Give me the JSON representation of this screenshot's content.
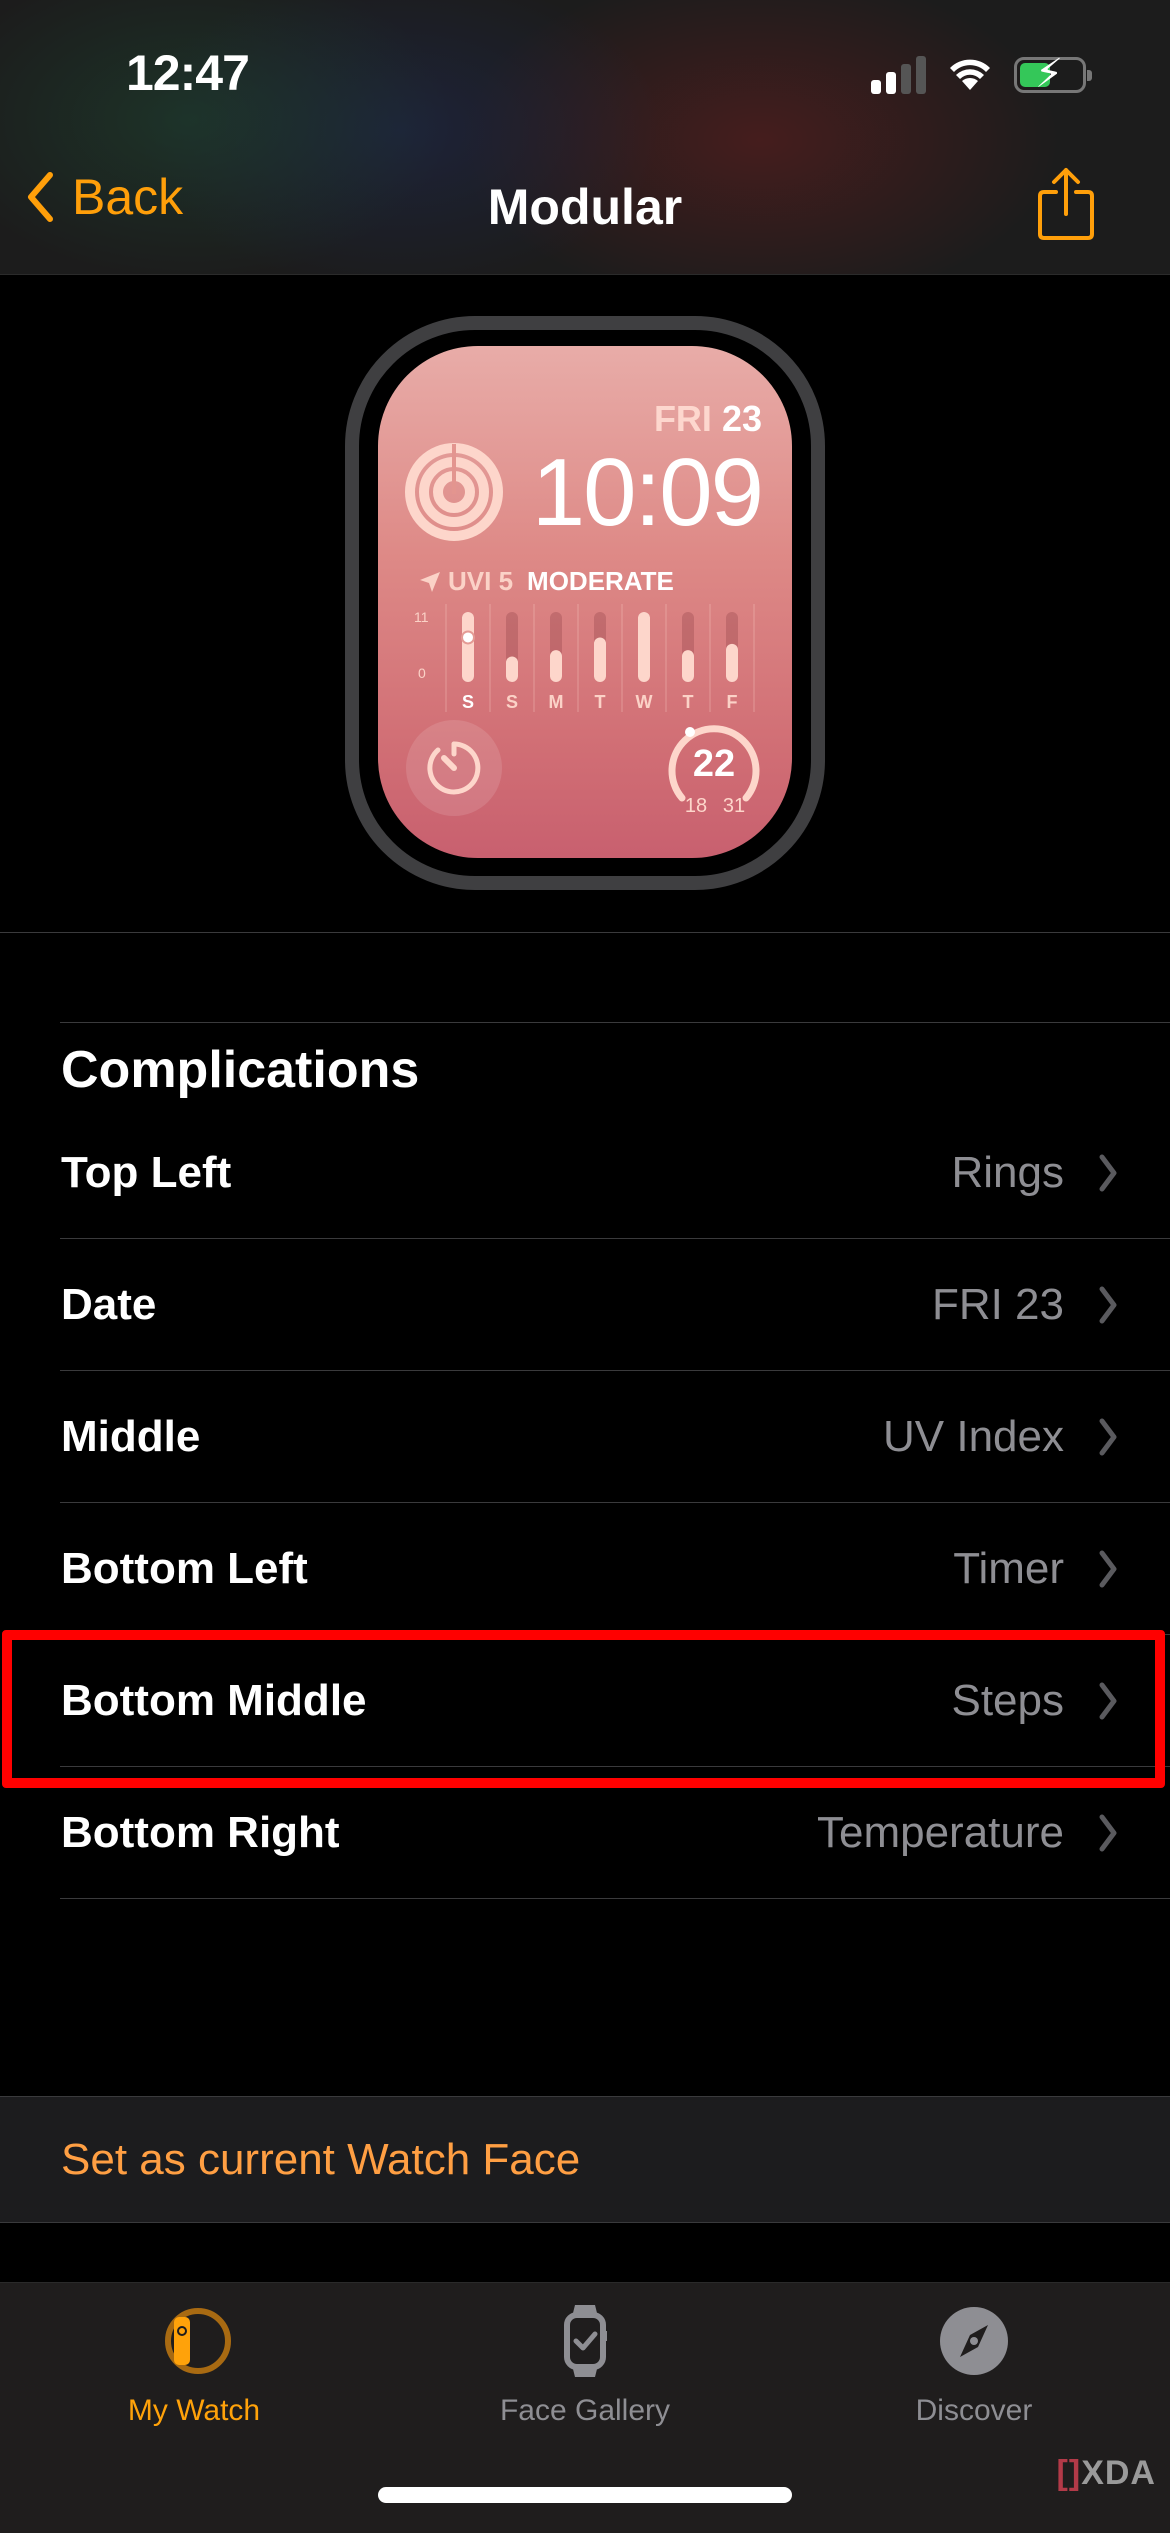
{
  "status_bar": {
    "time": "12:47",
    "signal_bars_active": 2,
    "signal_bars_total": 4,
    "battery_level": 0.5,
    "battery_charging": true,
    "battery_color": "#34c759"
  },
  "nav": {
    "back_label": "Back",
    "title": "Modular",
    "accent_color": "#ff9f0a"
  },
  "watch_face": {
    "day_of_week": "FRI",
    "day": "23",
    "time": "10:09",
    "uv": {
      "label": "UVI 5",
      "category": "MODERATE",
      "axis_max": "11",
      "axis_min": "0"
    },
    "temperature": {
      "current": "22",
      "low": "18",
      "high": "31"
    }
  },
  "chart_data": {
    "type": "bar",
    "title": "UVI 5 MODERATE",
    "categories": [
      "S",
      "S",
      "M",
      "T",
      "W",
      "T",
      "F"
    ],
    "values": [
      11,
      4,
      5,
      7,
      11,
      5,
      6
    ],
    "current_marker": {
      "category_index": 0,
      "value": 7
    },
    "ylim": [
      0,
      11
    ],
    "ytick_labels": [
      "11",
      "0"
    ],
    "xlabel": "",
    "ylabel": ""
  },
  "complications": {
    "heading": "Complications",
    "rows": [
      {
        "label": "Top Left",
        "value": "Rings"
      },
      {
        "label": "Date",
        "value": "FRI 23"
      },
      {
        "label": "Middle",
        "value": "UV Index"
      },
      {
        "label": "Bottom Left",
        "value": "Timer"
      },
      {
        "label": "Bottom Middle",
        "value": "Steps",
        "highlighted": true
      },
      {
        "label": "Bottom Right",
        "value": "Temperature"
      }
    ]
  },
  "actions": {
    "set_current": "Set as current Watch Face"
  },
  "tabbar": {
    "tabs": [
      {
        "label": "My Watch",
        "icon": "my-watch-icon",
        "active": true
      },
      {
        "label": "Face Gallery",
        "icon": "face-gallery-icon",
        "active": false
      },
      {
        "label": "Discover",
        "icon": "compass-icon",
        "active": false
      }
    ]
  },
  "watermark": {
    "brand": "XDA"
  }
}
